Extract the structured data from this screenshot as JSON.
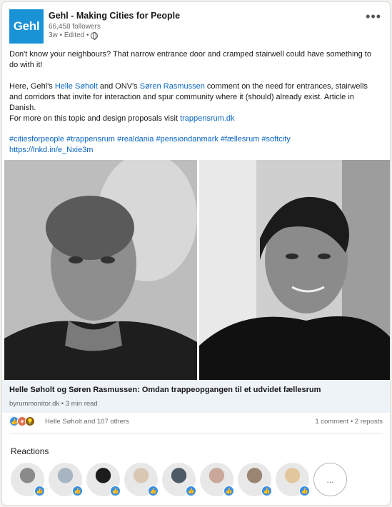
{
  "post": {
    "org_name": "Gehl - Making Cities for People",
    "logo_text": "Gehl",
    "followers": "66,458 followers",
    "meta": "3w • Edited •",
    "more_icon": "more-horizontal-icon",
    "p1": "Don't know your neighbours? That narrow entrance door and cramped stairwell could have something to do with it!",
    "p2_a": "Here, Gehl's ",
    "p2_name1": "Helle Søholt",
    "p2_b": " and ONV's ",
    "p2_name2": "Søren Rasmussen",
    "p2_c": " comment on the need for entrances, stairwells and corridors that invite for interaction and spur community where it (should) already exist. Article in Danish.",
    "p3_a": "For more on this topic and design proposals visit ",
    "p3_link": "trappensrum.dk",
    "hashtags": "#citiesforpeople #trappensrum #realdania #pensiondanmark #fællesrum #softcity",
    "shortlink": "https://lnkd.in/e_Nxie3m"
  },
  "article": {
    "title": "Helle Søholt og Søren Rasmussen: Omdan trappeopgangen til et udvidet fællesrum",
    "source": "byrummonitor.dk • 3 min read"
  },
  "social": {
    "reactions_text": "Helle Søholt and 107 others",
    "counts": "1 comment • 2 reposts",
    "icons": [
      "like-icon",
      "love-icon",
      "insightful-icon"
    ]
  },
  "reactions": {
    "title": "Reactions",
    "more_label": "...",
    "avatars": [
      {
        "name": "avatar-1",
        "color": "#8a8a8a"
      },
      {
        "name": "avatar-2",
        "color": "#a7b5c3"
      },
      {
        "name": "avatar-3",
        "color": "#1c1c1c"
      },
      {
        "name": "avatar-4",
        "color": "#d9c7b4"
      },
      {
        "name": "avatar-5",
        "color": "#4e5a66"
      },
      {
        "name": "avatar-6",
        "color": "#c9a89a"
      },
      {
        "name": "avatar-7",
        "color": "#9a8572"
      },
      {
        "name": "avatar-8",
        "color": "#e2c79d"
      }
    ]
  },
  "colors": {
    "link": "#0a66c2",
    "logo_bg": "#1a93d6",
    "like_blue": "#378fe9",
    "caption_bg": "#eef3f8"
  }
}
